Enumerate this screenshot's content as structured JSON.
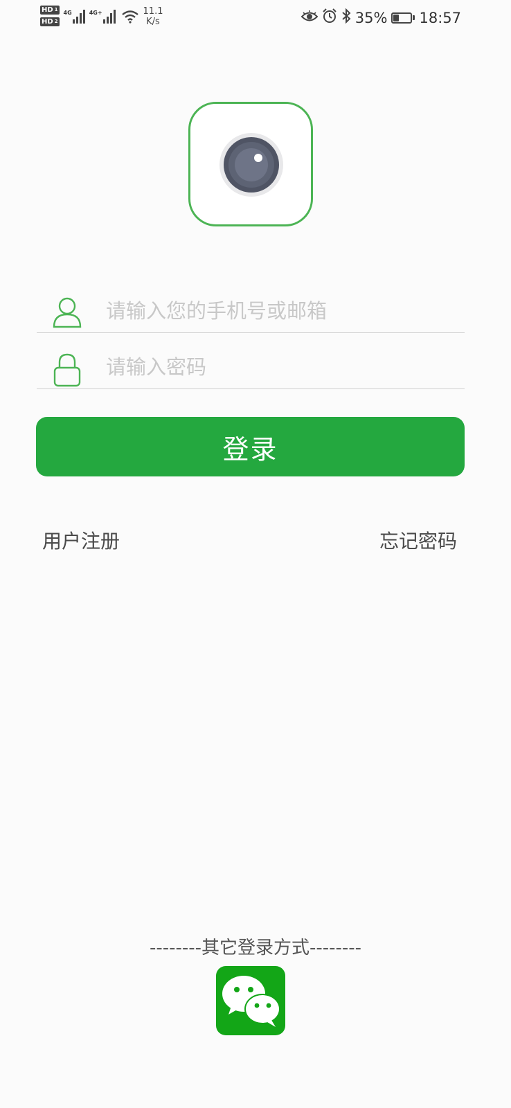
{
  "status_bar": {
    "hd1": "HD",
    "hd1_sub": "1",
    "hd2": "HD",
    "hd2_sub": "2",
    "net1": "4G",
    "net2": "4G+",
    "speed_value": "11.1",
    "speed_unit": "K/s",
    "battery": "35%",
    "battery_level": 0.35,
    "time": "18:57"
  },
  "login_form": {
    "phone_placeholder": "请输入您的手机号或邮箱",
    "password_placeholder": "请输入密码",
    "login_label": "登录"
  },
  "links": {
    "register": "用户注册",
    "forgot": "忘记密码"
  },
  "other_login": {
    "title": "--------其它登录方式--------"
  },
  "colors": {
    "accent": "#24a83f",
    "logo_border": "#4cb454",
    "wechat": "#13a617"
  }
}
